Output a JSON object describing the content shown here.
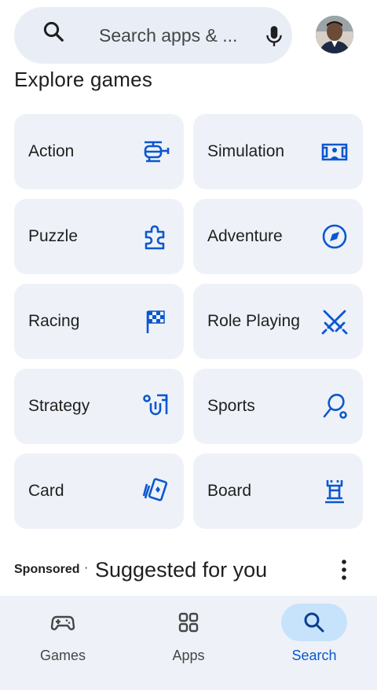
{
  "search": {
    "placeholder": "Search apps & ...",
    "icon": "search-icon",
    "voice_icon": "mic-icon"
  },
  "profile": {
    "avatar": "account-avatar"
  },
  "explore": {
    "title": "Explore games",
    "categories": [
      {
        "label": "Action",
        "icon": "helicopter-icon"
      },
      {
        "label": "Simulation",
        "icon": "simulation-icon"
      },
      {
        "label": "Puzzle",
        "icon": "puzzle-piece-icon"
      },
      {
        "label": "Adventure",
        "icon": "compass-icon"
      },
      {
        "label": "Racing",
        "icon": "checkered-flag-icon"
      },
      {
        "label": "Role Playing",
        "icon": "crossed-swords-icon"
      },
      {
        "label": "Strategy",
        "icon": "strategy-icon"
      },
      {
        "label": "Sports",
        "icon": "racket-icon"
      },
      {
        "label": "Card",
        "icon": "playing-cards-icon"
      },
      {
        "label": "Board",
        "icon": "chess-rook-icon"
      }
    ]
  },
  "suggested": {
    "sponsored_label": "Sponsored",
    "separator": "·",
    "title": "Suggested for you",
    "more_icon": "more-vert-icon"
  },
  "bottom_nav": {
    "items": [
      {
        "label": "Games",
        "icon": "gamepad-icon",
        "active": false
      },
      {
        "label": "Apps",
        "icon": "apps-grid-icon",
        "active": false
      },
      {
        "label": "Search",
        "icon": "search-icon",
        "active": true
      }
    ]
  },
  "colors": {
    "accent": "#0b57d0",
    "tile_background": "#eef2f8",
    "search_background": "#e9eef6",
    "active_pill": "#c7e3fb"
  }
}
